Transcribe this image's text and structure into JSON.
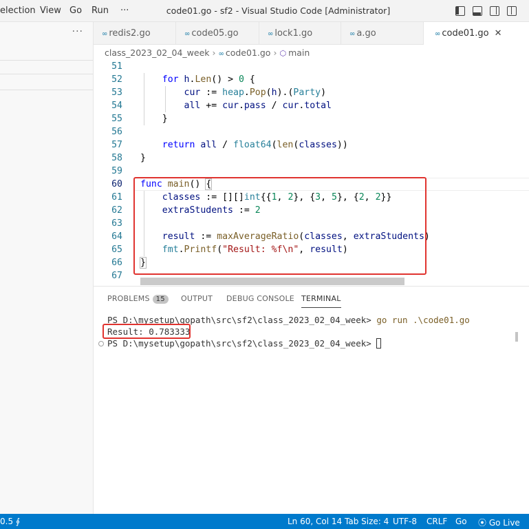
{
  "menu": [
    {
      "label": "election"
    },
    {
      "label": "View"
    },
    {
      "label": "Go"
    },
    {
      "label": "Run"
    },
    {
      "label": "···"
    }
  ],
  "window_title": "code01.go - sf2 - Visual Studio Code [Administrator]",
  "sidebar": {
    "more_label": "···"
  },
  "tabs": [
    {
      "label": "redis2.go",
      "icon": "go-file-icon"
    },
    {
      "label": "code05.go",
      "icon": "go-file-icon"
    },
    {
      "label": "lock1.go",
      "icon": "go-file-icon"
    },
    {
      "label": "a.go",
      "icon": "go-file-icon"
    },
    {
      "label": "code01.go",
      "icon": "go-file-icon",
      "active": true,
      "close": "✕"
    }
  ],
  "breadcrumb": {
    "folder": "class_2023_02_04_week",
    "file": "code01.go",
    "symbol": "main"
  },
  "editor": {
    "line_numbers": [
      "51",
      "52",
      "53",
      "54",
      "55",
      "56",
      "57",
      "58",
      "59",
      "60",
      "61",
      "62",
      "63",
      "64",
      "65",
      "66",
      "67"
    ],
    "code_lines": [
      "",
      "    for h.Len() > 0 {",
      "        cur := heap.Pop(h).(Party)",
      "        all += cur.pass / cur.total",
      "    }",
      "",
      "    return all / float64(len(classes))",
      "}",
      "",
      "func main() {",
      "    classes := [][]int{{1, 2}, {3, 5}, {2, 2}}",
      "    extraStudents := 2",
      "",
      "    result := maxAverageRatio(classes, extraStudents)",
      "    fmt.Printf(\"Result: %f\\n\", result)",
      "}",
      ""
    ],
    "current_line": "60"
  },
  "panel": {
    "tabs": [
      {
        "label": "PROBLEMS",
        "badge": "15"
      },
      {
        "label": "OUTPUT"
      },
      {
        "label": "DEBUG CONSOLE"
      },
      {
        "label": "TERMINAL",
        "active": true
      }
    ],
    "terminal": {
      "prompt1": "PS D:\\mysetup\\gopath\\src\\sf2\\class_2023_02_04_week> ",
      "command": "go run .\\code01.go",
      "output": "Result: 0.783333",
      "prompt2": "PS D:\\mysetup\\gopath\\src\\sf2\\class_2023_02_04_week> "
    }
  },
  "statusbar": {
    "left": "0.5",
    "position": "Ln 60, Col 14",
    "tab_size": "Tab Size: 4",
    "encoding": "UTF-8",
    "eol": "CRLF",
    "language": "Go",
    "live": "Go Live"
  },
  "colors": {
    "status_bar": "#007acc",
    "annotation_red": "#e0332f",
    "keyword": "#0000ff",
    "function": "#795e26",
    "string": "#a31515",
    "number": "#098658",
    "type": "#267f99"
  }
}
